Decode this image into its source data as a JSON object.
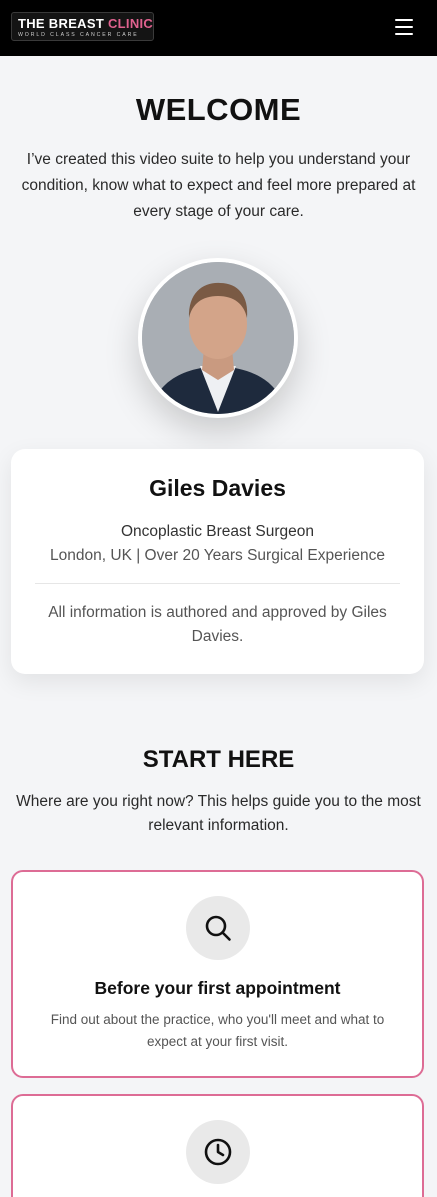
{
  "header": {
    "logo_text_main": "THE BREAST ",
    "logo_text_accent": "CLINIC",
    "logo_tagline": "WORLD CLASS CANCER CARE",
    "menu_icon": "hamburger-menu-icon"
  },
  "welcome": {
    "title": "WELCOME",
    "intro": "I’ve created this video suite to help you understand your condition, know what to expect and feel more prepared at every stage of your care."
  },
  "profile": {
    "photo_icon": "surgeon-portrait",
    "name": "Giles Davies",
    "role": "Oncoplastic Breast Surgeon",
    "meta": "London, UK | Over 20 Years Surgical Experience",
    "note": "All information is authored and approved by Giles Davies."
  },
  "start_here": {
    "title": "START HERE",
    "intro": "Where are you right now? This helps guide you to the most relevant information.",
    "cards": [
      {
        "icon": "search-icon",
        "title": "Before your first appointment",
        "description": "Find out about the practice, who you'll meet and what to expect at your first visit."
      },
      {
        "icon": "clock-icon"
      }
    ]
  },
  "colors": {
    "accent": "#dd6c95",
    "header_bg": "#000000",
    "page_bg": "#f4f5f7"
  }
}
